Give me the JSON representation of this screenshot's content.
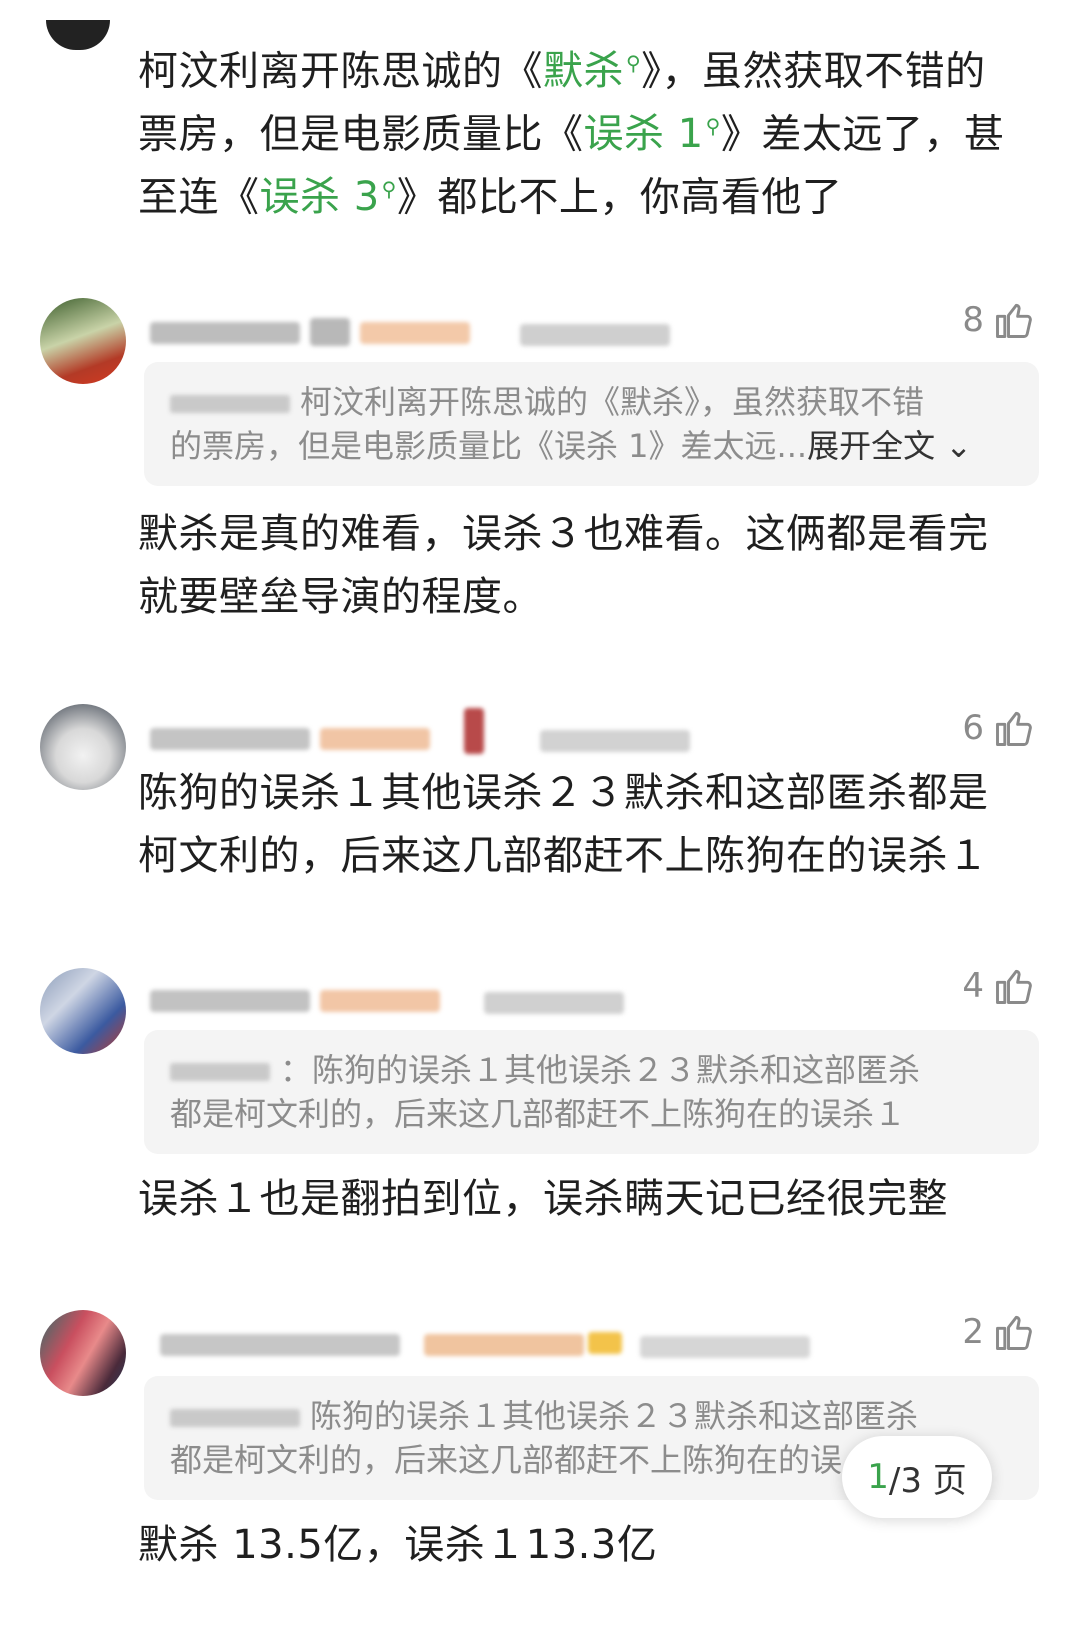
{
  "main_comment": {
    "line1_a": "柯汶利离开陈思诚的《",
    "line1_link": "默杀",
    "line1_b": "》，虽然获取不错的",
    "line2_a": "票房，但是电影质量比《",
    "line2_link": "误杀 1",
    "line2_b": "》差太远了，甚",
    "line3_a": "至连《",
    "line3_link": "误杀 3",
    "line3_b": "》都比不上，你高看他了"
  },
  "replies": [
    {
      "likes": "8",
      "quote_line1": "柯汶利离开陈思诚的《默杀》，虽然获取不错",
      "quote_line2": "的票房，但是电影质量比《误杀 1》差太远...",
      "expand": "展开全文",
      "text_line1": "默杀是真的难看，误杀３也难看。这俩都是看完",
      "text_line2": "就要壁垒导演的程度。"
    },
    {
      "likes": "6",
      "text_line1": "陈狗的误杀１其他误杀２３默杀和这部匿杀都是",
      "text_line2": "柯文利的，后来这几部都赶不上陈狗在的误杀１"
    },
    {
      "likes": "4",
      "quote_line1": "：陈狗的误杀１其他误杀２３默杀和这部匿杀",
      "quote_line2": "都是柯文利的，后来这几部都赶不上陈狗在的误杀１",
      "text_line1": "误杀１也是翻拍到位，误杀瞒天记已经很完整"
    },
    {
      "likes": "2",
      "quote_line1": "陈狗的误杀１其他误杀２３默杀和这部匿杀",
      "quote_line2": "都是柯文利的，后来这几部都赶不上陈狗在的误",
      "text_line1": "默杀 13.5亿，误杀１13.3亿"
    }
  ],
  "pager": {
    "current": "1",
    "total": "/3 页"
  },
  "icons": {
    "search": "search-icon",
    "like": "thumbs-up-icon",
    "chevron": "chevron-down-icon"
  },
  "colors": {
    "link": "#3aa34c",
    "quote_bg": "#f4f4f4"
  }
}
